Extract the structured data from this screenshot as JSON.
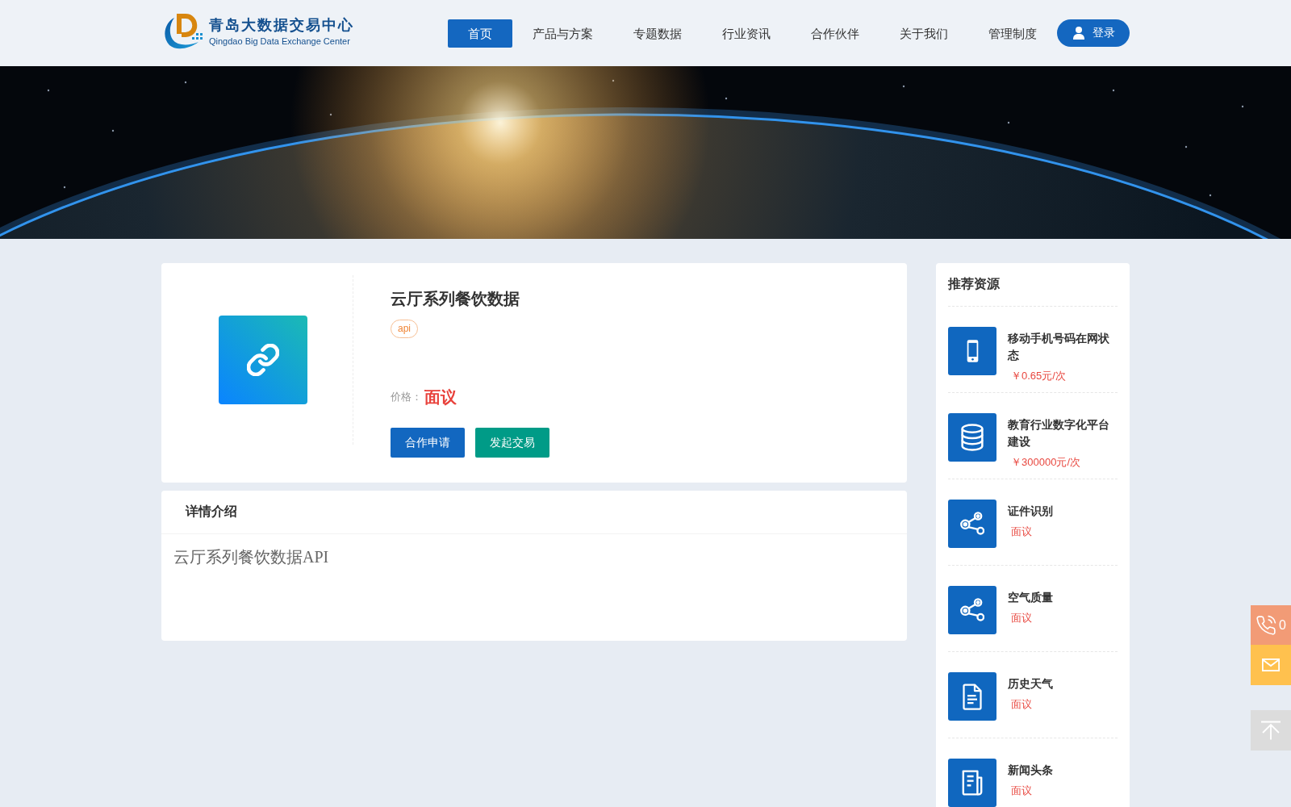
{
  "header": {
    "logo": {
      "title": "青岛大数据交易中心",
      "subtitle": "Qingdao Big Data Exchange Center"
    },
    "nav": [
      {
        "label": "首页",
        "selected": true
      },
      {
        "label": "产品与方案",
        "selected": false
      },
      {
        "label": "专题数据",
        "selected": false
      },
      {
        "label": "行业资讯",
        "selected": false
      },
      {
        "label": "合作伙伴",
        "selected": false
      },
      {
        "label": "关于我们",
        "selected": false
      },
      {
        "label": "管理制度",
        "selected": false
      }
    ],
    "login_button": "登录"
  },
  "product": {
    "title": "云厅系列餐饮数据",
    "tag": "api",
    "price_label": "价格：",
    "price": "面议",
    "buttons": [
      {
        "label": "合作申请",
        "kind": "apply"
      },
      {
        "label": "发起交易",
        "kind": "trade"
      }
    ]
  },
  "details": {
    "heading": "详情介绍",
    "body": "云厅系列餐饮数据API"
  },
  "sidebar": {
    "title": "推荐资源",
    "items": [
      {
        "name": "移动手机号码在网状态",
        "price": "￥0.65元/次",
        "kind": "mobile"
      },
      {
        "name": "教育行业数字化平台建设",
        "price": "￥300000元/次",
        "kind": "database"
      },
      {
        "name": "证件识别",
        "price": "面议",
        "kind": "nodes"
      },
      {
        "name": "空气质量",
        "price": "面议",
        "kind": "nodes"
      },
      {
        "name": "历史天气",
        "price": "面议",
        "kind": "document"
      },
      {
        "name": "新闻头条",
        "price": "面议",
        "kind": "news"
      }
    ]
  },
  "contact_bar": {
    "phone_text": "0"
  }
}
